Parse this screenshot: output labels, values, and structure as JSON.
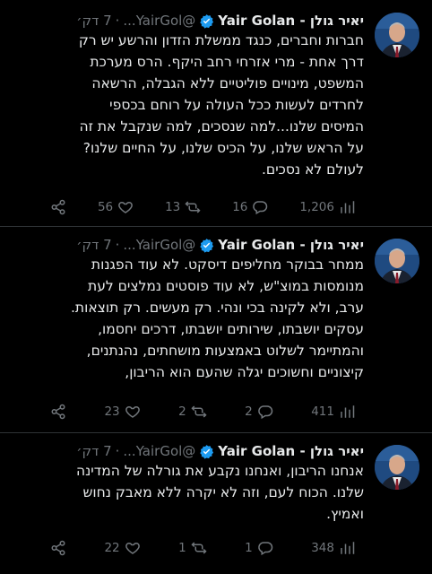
{
  "tweets": [
    {
      "author_name": "יאיר גולן - Yair Golan",
      "handle": "@YairGol...",
      "separator": "·",
      "time": "7 דק׳",
      "lines": [
        "חברות וחברים, כנגד ממשלת הזדון והרשע יש רק",
        "דרך אחת - מרי אזרחי רחב היקף. הרס מערכת",
        "המשפט, מינויים פוליטיים ללא הגבלה, הרשאה",
        "לחרדים לעשות ככל העולה על רוחם בכספי",
        "המיסים שלנו...למה שנסכים, למה שנקבל את זה",
        "על הראש שלנו, על הכיס שלנו, על החיים שלנו?",
        "לעולם לא נסכים."
      ],
      "views": "1,206",
      "replies": "16",
      "retweets": "13",
      "likes": "56"
    },
    {
      "author_name": "יאיר גולן - Yair Golan",
      "handle": "@YairGol...",
      "separator": "·",
      "time": "7 דק׳",
      "lines": [
        "ממחר בבוקר מחליפים דיסקט. לא עוד הפגנות",
        "מנומסות במוצ\"ש, לא עוד פוסטים נמלצים לעת",
        "ערב, ולא לקינה בכי ונהי. רק מעשים. רק תוצאות.",
        "עסקים יושבתו, שירותים יושבתו, דרכים יחסמו,",
        "והמתיימר לשלוט באמצעות מושחתים, נהנתנים,",
        "קיצוניים וחשוכים יגלה שהעם הוא הריבון,"
      ],
      "views": "411",
      "replies": "2",
      "retweets": "2",
      "likes": "23"
    },
    {
      "author_name": "יאיר גולן - Yair Golan",
      "handle": "@YairGol...",
      "separator": "·",
      "time": "7 דק׳",
      "lines": [
        "אנחנו הריבון, ואנחנו נקבע את גורלה של המדינה",
        "שלנו. הכוח לעם, וזה לא יקרה ללא מאבק נחוש",
        "ואמיץ."
      ],
      "views": "348",
      "replies": "1",
      "retweets": "1",
      "likes": "22"
    }
  ],
  "colors": {
    "background": "#000000",
    "text": "#e7e9ea",
    "muted": "#71767b",
    "verified": "#1d9bf0",
    "divider": "#2f3336"
  },
  "icons": {
    "verified": "verified-badge-icon",
    "views": "bar-chart-icon",
    "reply": "speech-bubble-icon",
    "retweet": "retweet-icon",
    "like": "heart-icon",
    "share": "share-icon"
  }
}
